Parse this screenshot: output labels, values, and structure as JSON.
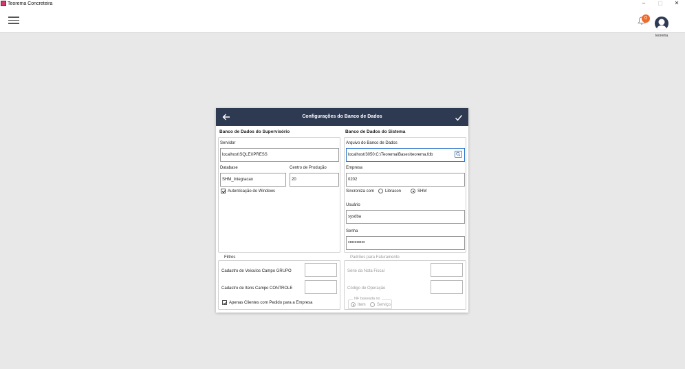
{
  "window": {
    "title": "Teorema Concreteira",
    "min": "–",
    "max": "▢",
    "close": "✕"
  },
  "header": {
    "notification_count": "0",
    "user_name": "teorema"
  },
  "dialog": {
    "title": "Configurações do Banco de Dados",
    "supervisor": {
      "section_title": "Banco de Dados do Supervisório",
      "server_label": "Servidor",
      "server_value": "localhost\\SQLEXPRESS",
      "database_label": "Database",
      "database_value": "SHM_Integracao",
      "production_center_label": "Centro de Produção",
      "production_center_value": "20",
      "windows_auth_label": "Autenticação do Windows",
      "windows_auth_checked": true
    },
    "system": {
      "section_title": "Banco de Dados do Sistema",
      "db_file_label": "Arquivo do Banco de Dados",
      "db_file_value": "localhost/3050:C:\\Teorema\\Bases\\teorema.fdb",
      "company_label": "Empresa",
      "company_value": "0202",
      "sync_label": "Sincroniza com",
      "sync_options": [
        "Libracon",
        "SHM"
      ],
      "sync_selected": "SHM",
      "user_label": "Usuário",
      "user_value": "sysdba",
      "password_label": "Senha",
      "password_value": "••••••••••"
    },
    "filters": {
      "legend": "Filtros",
      "vehicles_label": "Cadastro de Veículos Campo GRUPO",
      "vehicles_value": "",
      "items_label": "Cadastro de Itens Campo CONTROLE",
      "items_value": "",
      "only_clients_label": "Apenas Clientes com Pedido para a Empresa",
      "only_clients_checked": true
    },
    "billing": {
      "legend": "Padrões para Faturamento",
      "invoice_series_label": "Série da Nota Fiscal",
      "invoice_series_value": "",
      "operation_code_label": "Código de Operação",
      "operation_code_value": "",
      "nf_based_legend": "NF baseada no",
      "nf_options": [
        "Item",
        "Serviço"
      ],
      "nf_selected": "Item"
    }
  },
  "colors": {
    "dialog_header": "#2e3a52",
    "badge": "#f06a2a",
    "focus_border": "#2b73c9"
  }
}
